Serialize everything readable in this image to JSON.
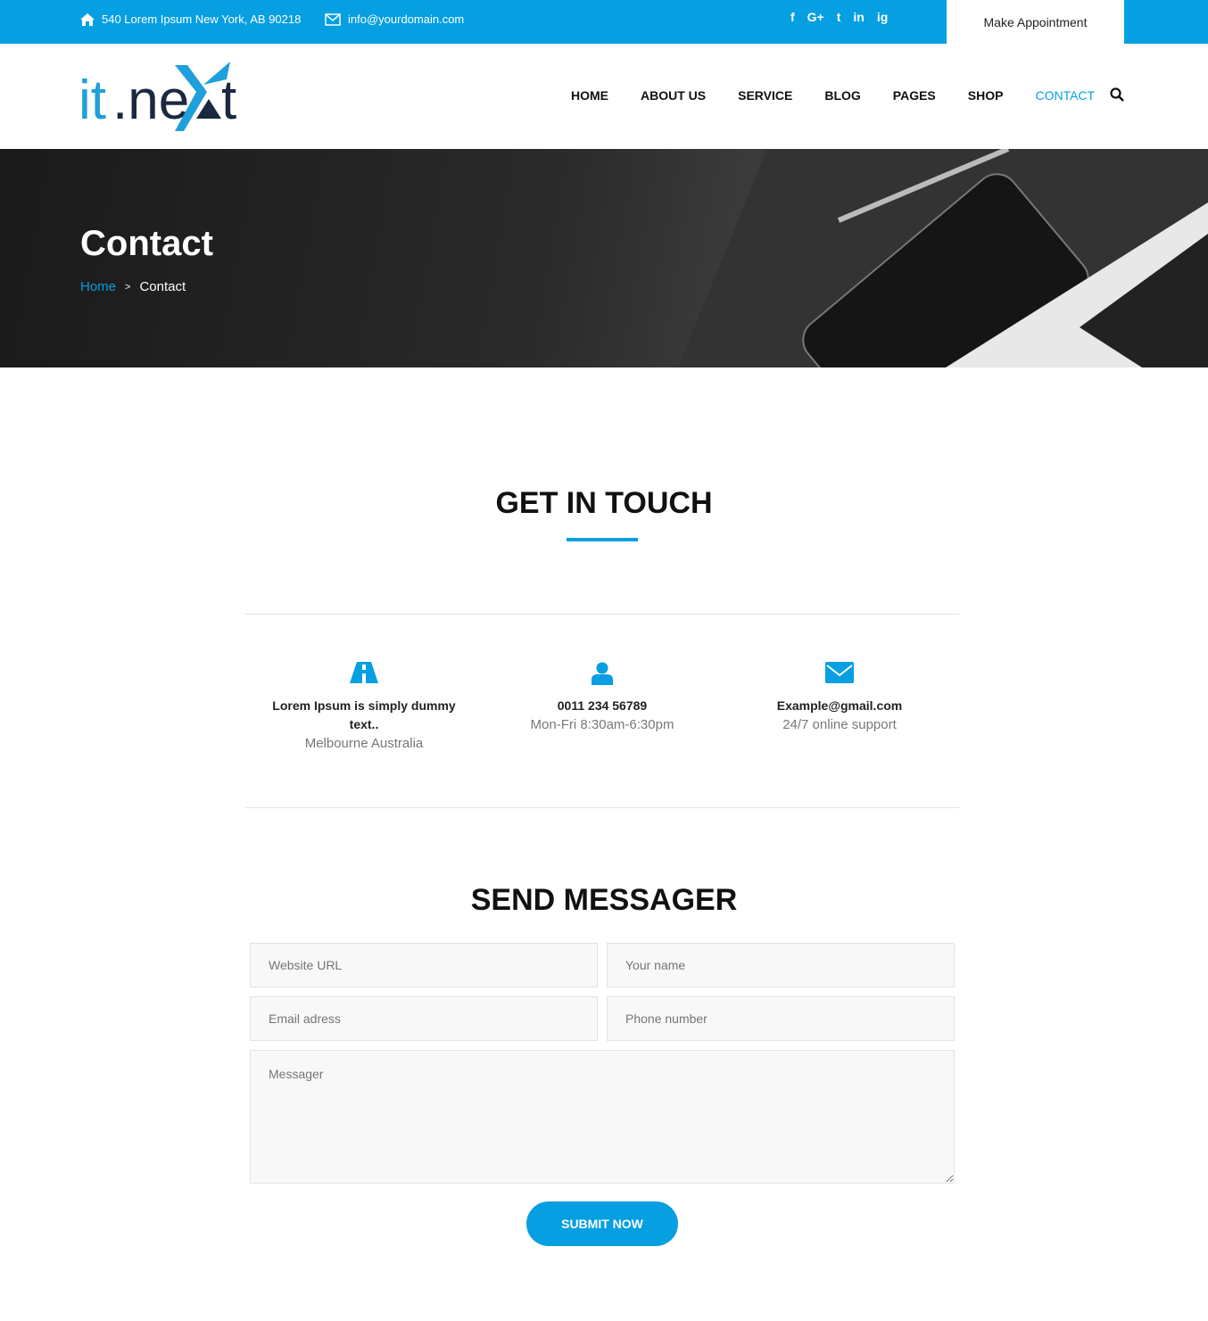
{
  "topbar": {
    "address": "540 Lorem Ipsum New York, AB 90218",
    "email": "info@yourdomain.com",
    "social": [
      "f",
      "G+",
      "t",
      "in",
      "ig"
    ],
    "appointment": "Make Appointment"
  },
  "logo": {
    "text": "it.next"
  },
  "nav": {
    "items": [
      "HOME",
      "ABOUT US",
      "SERVICE",
      "BLOG",
      "PAGES",
      "SHOP",
      "CONTACT"
    ],
    "active": "CONTACT"
  },
  "hero": {
    "title": "Contact",
    "breadcrumb": [
      "Home",
      "Contact"
    ]
  },
  "touch": {
    "title": "GET IN TOUCH",
    "items": [
      {
        "icon": "road-icon",
        "title": "Lorem Ipsum is simply dummy text..",
        "sub": "Melbourne Australia"
      },
      {
        "icon": "user-icon",
        "title": "0011 234 56789",
        "sub": "Mon-Fri 8:30am-6:30pm"
      },
      {
        "icon": "envelope-icon",
        "title": "Example@gmail.com",
        "sub": "24/7 online support"
      }
    ]
  },
  "form": {
    "title": "SEND MESSAGER",
    "website": "Website URL",
    "name": "Your name",
    "email": "Email adress",
    "phone": "Phone number",
    "message": "Messager",
    "submit": "SUBMIT NOW"
  },
  "colors": {
    "accent": "#059fe2"
  }
}
